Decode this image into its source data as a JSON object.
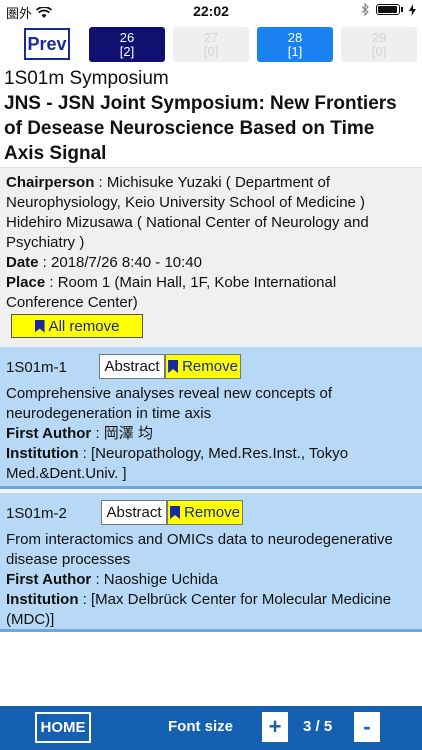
{
  "status": {
    "carrier": "圏外",
    "time": "22:02"
  },
  "nav": {
    "prev_label": "Prev",
    "tabs": [
      {
        "day": "26",
        "count": "[2]",
        "state": "dark"
      },
      {
        "day": "27",
        "count": "[0]",
        "state": "disabled"
      },
      {
        "day": "28",
        "count": "[1]",
        "state": "blue"
      },
      {
        "day": "29",
        "count": "[0]",
        "state": "disabled"
      }
    ]
  },
  "session": {
    "code": "1S01m Symposium",
    "title": "JNS - JSN Joint Symposium: New Frontiers of Desease Neuroscience Based on Time Axis Signal",
    "chairperson_label": "Chairperson",
    "chairperson_value": " : Michisuke Yuzaki ( Department of Neurophysiology, Keio University School of Medicine ) Hidehiro Mizusawa ( National Center of Neurology and Psychiatry )",
    "date_label": "Date",
    "date_value": " : 2018/7/26 8:40 - 10:40",
    "place_label": "Place",
    "place_value": " : Room 1 (Main Hall, 1F, Kobe International Conference Center)",
    "all_remove_label": "All remove"
  },
  "presentations": [
    {
      "code": "1S01m-1",
      "abstract_label": "Abstract",
      "remove_label": "Remove",
      "title": "Comprehensive analyses reveal new concepts of neurodegeneration in time axis",
      "author_label": "First Author",
      "author_value": " : 岡澤 均",
      "institution_label": "Institution",
      "institution_value": " : [Neuropathology, Med.Res.Inst., Tokyo Med.&Dent.Univ. ]"
    },
    {
      "code": "1S01m-2",
      "abstract_label": "Abstract",
      "remove_label": "Remove",
      "title": "From interactomics and OMICs data to neurodegenerative disease processes",
      "author_label": "First Author",
      "author_value": " :  Naoshige Uchida",
      "institution_label": "Institution",
      "institution_value": " : [Max Delbrück Center for Molecular Medicine (MDC)]"
    }
  ],
  "toolbar": {
    "home_label": "HOME",
    "font_size_label": "Font size",
    "plus_label": "+",
    "minus_label": "-",
    "page_indicator": "3 / 5"
  },
  "colors": {
    "nav_dark": "#101070",
    "nav_blue": "#1a82f0",
    "card_bg": "#b8d9f6",
    "remove_yellow": "#ffff00",
    "toolbar_bg": "#1560b0"
  }
}
